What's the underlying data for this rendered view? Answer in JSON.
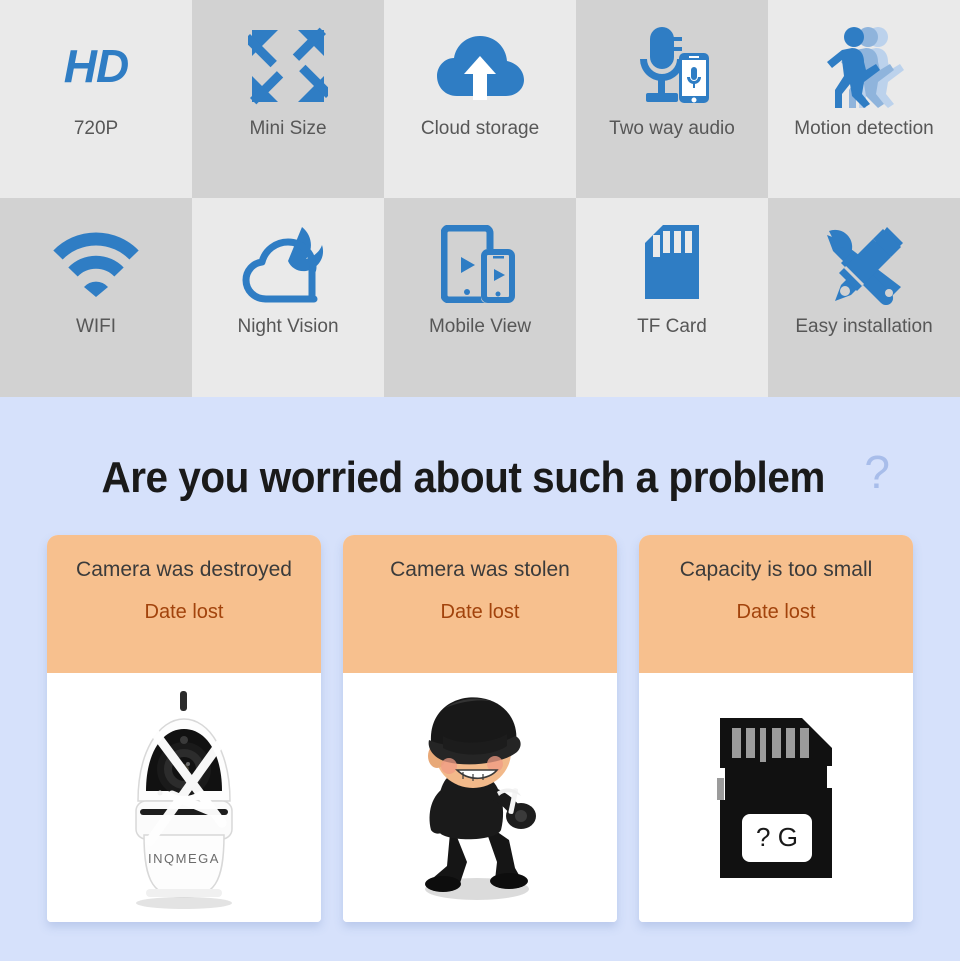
{
  "features": {
    "row1": [
      {
        "label": "720P",
        "icon": "hd-icon",
        "shade": "light",
        "icon_text": "HD"
      },
      {
        "label": "Mini Size",
        "icon": "compress-arrows-icon",
        "shade": "dark"
      },
      {
        "label": "Cloud storage",
        "icon": "cloud-upload-icon",
        "shade": "light"
      },
      {
        "label": "Two way audio",
        "icon": "microphone-phone-icon",
        "shade": "dark"
      },
      {
        "label": "Motion detection",
        "icon": "walking-person-icon",
        "shade": "light"
      }
    ],
    "row2": [
      {
        "label": "WIFI",
        "icon": "wifi-icon",
        "shade": "dark"
      },
      {
        "label": "Night Vision",
        "icon": "cloud-moon-icon",
        "shade": "light"
      },
      {
        "label": "Mobile View",
        "icon": "tablet-phone-icon",
        "shade": "dark"
      },
      {
        "label": "TF Card",
        "icon": "sd-card-icon",
        "shade": "light"
      },
      {
        "label": "Easy installation",
        "icon": "wrench-screwdriver-icon",
        "shade": "dark"
      }
    ]
  },
  "problem": {
    "headline": "Are you worried about such a problem",
    "headline_question_mark": "?",
    "cards": [
      {
        "title": "Camera was destroyed",
        "subtitle": "Date lost",
        "image": "broken-camera-image",
        "brand_text": "INQMEGA"
      },
      {
        "title": "Camera was stolen",
        "subtitle": "Date lost",
        "image": "thief-image"
      },
      {
        "title": "Capacity is too small",
        "subtitle": "Date lost",
        "image": "sd-card-image",
        "card_label": "? G"
      }
    ]
  },
  "colors": {
    "accent_blue": "#2f7dc4",
    "section_bg": "#d6e1fb",
    "card_header": "#f7c08e",
    "card_subtitle": "#a2430c",
    "grid_light": "#eaeaea",
    "grid_dark": "#d2d2d2"
  }
}
